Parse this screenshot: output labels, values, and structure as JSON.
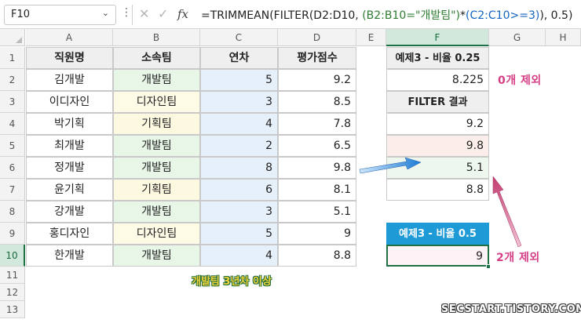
{
  "formula_bar": {
    "name_box": "F10",
    "formula_a": "=TRIMMEAN(FILTER(D2:D10, ",
    "formula_b": "(B2:B10=\"개발팀\")",
    "formula_c": "*",
    "formula_d": "(C2:C10>=3)",
    "formula_e": "), 0.5)"
  },
  "columns": [
    "A",
    "B",
    "C",
    "D",
    "E",
    "F",
    "G",
    "H"
  ],
  "rows": [
    "1",
    "2",
    "3",
    "4",
    "5",
    "6",
    "7",
    "8",
    "9",
    "10",
    "11",
    "12",
    "13"
  ],
  "table": {
    "headers": [
      "직원명",
      "소속팀",
      "연차",
      "평가점수"
    ],
    "rows": [
      {
        "name": "김개발",
        "team": "개발팀",
        "years": "5",
        "score": "9.2"
      },
      {
        "name": "이디자인",
        "team": "디자인팀",
        "years": "3",
        "score": "8.5"
      },
      {
        "name": "박기획",
        "team": "기획팀",
        "years": "4",
        "score": "7.8"
      },
      {
        "name": "최개발",
        "team": "개발팀",
        "years": "2",
        "score": "6.5"
      },
      {
        "name": "정개발",
        "team": "개발팀",
        "years": "8",
        "score": "9.8"
      },
      {
        "name": "윤기획",
        "team": "기획팀",
        "years": "6",
        "score": "8.1"
      },
      {
        "name": "강개발",
        "team": "개발팀",
        "years": "3",
        "score": "5.1"
      },
      {
        "name": "홍디자인",
        "team": "디자인팀",
        "years": "5",
        "score": "9"
      },
      {
        "name": "한개발",
        "team": "개발팀",
        "years": "4",
        "score": "8.8"
      }
    ]
  },
  "example1": {
    "title": "예제3 - 비율 0.25",
    "value": "8.225"
  },
  "filter_result": {
    "title": "FILTER 결과",
    "values": [
      "9.2",
      "9.8",
      "5.1",
      "8.8"
    ]
  },
  "example2": {
    "title": "예제3 - 비율 0.5",
    "value": "9"
  },
  "annotations": {
    "zero_excluded": "0개 제외",
    "two_excluded": "2개 제외",
    "condition": "개발팀 3년차 이상",
    "watermark": "SECSTART.TISTORY.COM"
  },
  "colors": {
    "accent": "#1e7145",
    "blue_header": "#1e9ad6",
    "annotation_pink": "#d63f86",
    "arrow_blue": "#1e7bd4",
    "arrow_pink": "#c23a6e"
  }
}
